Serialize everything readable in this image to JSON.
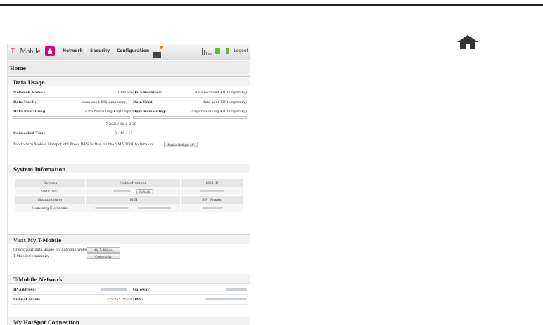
{
  "navbar": {
    "logo_t": "T",
    "logo_rest": "··Mobile",
    "items": [
      "Network",
      "Security",
      "Configuration"
    ],
    "logout": "Logout"
  },
  "breadcrumb": "Home",
  "data_usage": {
    "title": "Data Usage",
    "network_name_label": "Network Name :",
    "network_name_value": "T-Mobile",
    "data_received_label": "Data Received:",
    "data_received_value": "data received KB(temporary)",
    "data_used_label": "Data Used :",
    "data_used_value": "data used KB(temporary)",
    "data_sent_label": "Data Sent:",
    "data_sent_value": "data sent KB(temporary)",
    "data_remaining_label": "Data Remaining:",
    "data_remaining_value": "data remaining KB(temporary)",
    "days_remaining_label": "Days Remaining:",
    "days_remaining_value": "days remaining KB(temporary)",
    "usage_readout": "7.3GB / 10.0 0GB",
    "connected_time_label": "Connected Time:",
    "connected_time_value": "0 : 19 : 11",
    "hotspot_hint": "Tap to turn Mobile Hotspot off. Press WPS button on the SM-V100T to turn on.",
    "hotspot_button": "Mobile HotSpot off"
  },
  "system_info": {
    "title": "System Infomation",
    "headers_1": [
      "Devices",
      "MobileNumber",
      "SIM ID"
    ],
    "row_1_device": "SMV100T",
    "refresh_button": "Refresh",
    "headers_2": [
      "Manufacturer",
      "IMEI",
      "SW Version"
    ],
    "row_2_manufacturer": "Samsung Electronis"
  },
  "visit": {
    "title": "Visit My T-Mobile",
    "line1": "Check your data usage on T-Mobile Website :",
    "line2": "T-MobileCommunity :",
    "my_tmobile_button": "My T··Mobile",
    "community_button": "Community"
  },
  "network": {
    "title": "T-Mobile Network",
    "ip_label": "IP Address:",
    "gateway_label": "Gateway",
    "subnet_label": "Subnet Mask:",
    "subnet_value": "255.255.255.0",
    "dns_label": "DNS:"
  },
  "hotspot": {
    "title": "My HotSpot Connection"
  }
}
